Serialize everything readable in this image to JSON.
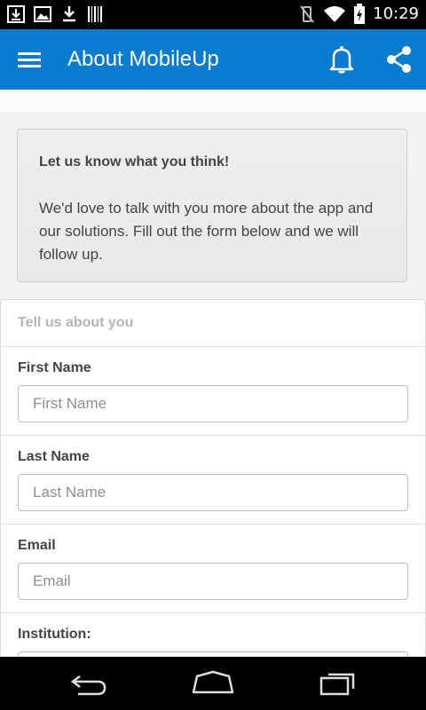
{
  "status_bar": {
    "time": "10:29",
    "left_icons": [
      "download-icon",
      "image-icon",
      "download-arrow-icon",
      "barcode-icon"
    ],
    "right_icons": [
      "vibrate-off-icon",
      "wifi-icon",
      "battery-charging-icon"
    ]
  },
  "app_bar": {
    "title": "About MobileUp",
    "color": "#0a7ccf",
    "icons": [
      "menu-icon",
      "bell-icon",
      "share-icon"
    ]
  },
  "intro": {
    "heading": "Let us know what you think!",
    "body": "We'd love to talk with you more about the app and our solutions. Fill out the form below and we will follow up."
  },
  "form": {
    "header": "Tell us about you",
    "fields": [
      {
        "label": "First Name",
        "placeholder": "First Name",
        "value": ""
      },
      {
        "label": "Last Name",
        "placeholder": "Last Name",
        "value": ""
      },
      {
        "label": "Email",
        "placeholder": "Email",
        "value": ""
      },
      {
        "label": "Institution:",
        "placeholder": "",
        "value": ""
      }
    ]
  },
  "nav_bar": {
    "buttons": [
      "back-icon",
      "home-icon",
      "recent-apps-icon"
    ]
  }
}
